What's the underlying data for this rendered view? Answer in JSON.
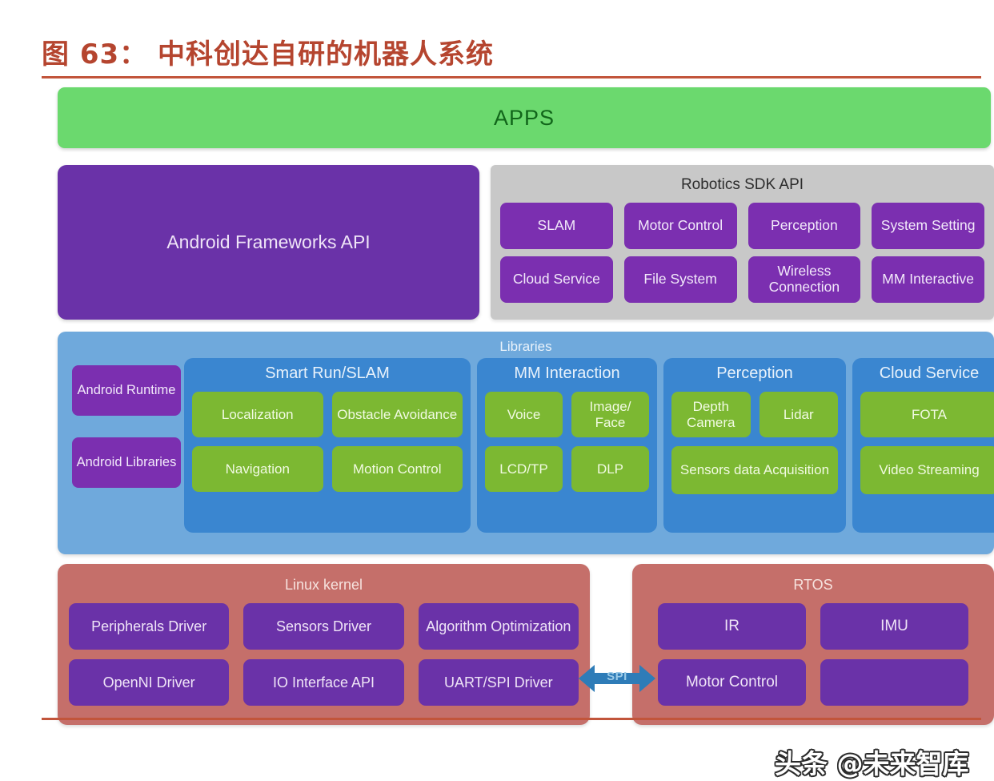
{
  "title": {
    "text": "图 63： 中科创达自研的机器人系统"
  },
  "apps": {
    "label": "APPS"
  },
  "frameworks": {
    "label": "Android Frameworks API"
  },
  "sdk": {
    "title": "Robotics SDK API",
    "items": [
      "SLAM",
      "Motor Control",
      "Perception",
      "System Setting",
      "Cloud Service",
      "File System",
      "Wireless Connection",
      "MM Interactive"
    ]
  },
  "libraries": {
    "title": "Libraries",
    "android": [
      "Android Runtime",
      "Android Libraries"
    ],
    "groups": [
      {
        "title": "Smart Run/SLAM",
        "row1": [
          "Localization",
          "Obstacle Avoidance"
        ],
        "row2": [
          "Navigation",
          "Motion Control"
        ]
      },
      {
        "title": "MM Interaction",
        "row1": [
          "Voice",
          "Image/ Face"
        ],
        "row2": [
          "LCD/TP",
          "DLP"
        ]
      },
      {
        "title": "Perception",
        "row1": [
          "Depth Camera",
          "Lidar"
        ],
        "row2": [
          "Sensors data Acquisition"
        ]
      },
      {
        "title": "Cloud Service",
        "row1": [
          "FOTA"
        ],
        "row2": [
          "Video Streaming"
        ]
      }
    ]
  },
  "linux_kernel": {
    "title": "Linux kernel",
    "row1": [
      "Peripherals Driver",
      "Sensors Driver",
      "Algorithm Optimization"
    ],
    "row2": [
      "OpenNI Driver",
      "IO Interface API",
      "UART/SPI Driver"
    ]
  },
  "rtos": {
    "title": "RTOS",
    "row1": [
      "IR",
      "IMU"
    ],
    "row2": [
      "Motor Control",
      ""
    ]
  },
  "bus": {
    "label": "SPI"
  },
  "watermark": {
    "text": "头条 @未来智库"
  },
  "colors": {
    "title_red": "#B5452F",
    "apps_green": "#6BD96E",
    "purple": "#6A32A8",
    "sdk_purple": "#7B2FB0",
    "sdk_panel_gray": "#C8C8C8",
    "libraries_blue": "#6FA9DC",
    "group_blue": "#3A86D0",
    "leaf_green": "#7CB832",
    "kernel_salmon": "#C56F6A",
    "bus_blue": "#2E7CB8"
  }
}
